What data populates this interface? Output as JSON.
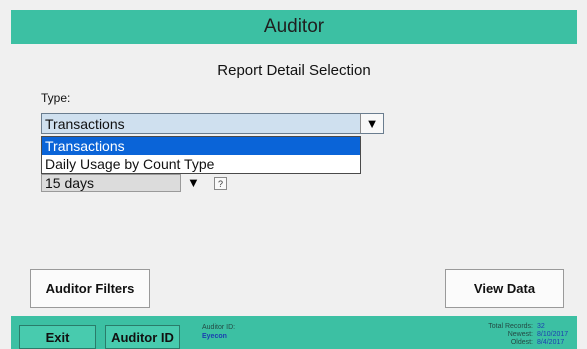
{
  "window": {
    "title": "Auditor"
  },
  "section": {
    "title": "Report Detail Selection"
  },
  "type_field": {
    "label": "Type:",
    "selected": "Transactions",
    "options": [
      "Transactions",
      "Daily Usage by Count Type"
    ]
  },
  "period_field": {
    "selected": "15 days",
    "help_label": "?"
  },
  "buttons": {
    "filters": "Auditor Filters",
    "view_data": "View Data",
    "exit": "Exit",
    "auditor_id": "Auditor ID"
  },
  "footer": {
    "auditor_id_label": "Auditor ID:",
    "auditor_id_value": "Eyecon",
    "total_records_label": "Total Records:",
    "total_records_value": "32",
    "newest_label": "Newest:",
    "newest_value": "8/10/2017",
    "oldest_label": "Oldest:",
    "oldest_value": "8/4/2017"
  },
  "colors": {
    "teal": "#3cc0a3",
    "selection_blue": "#0a64d8",
    "select_bg": "#cfe0ef"
  },
  "icons": {
    "dropdown_arrow": "triangle-down-icon"
  }
}
